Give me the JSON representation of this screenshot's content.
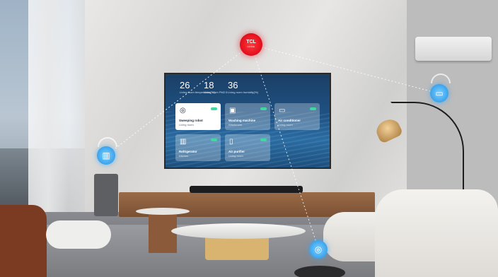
{
  "hub": {
    "brand": "TCL",
    "sub": "HOME",
    "color": "#e10d1c"
  },
  "tv": {
    "stats": [
      {
        "value": "26",
        "label": "Living room temperature(°C)"
      },
      {
        "value": "18",
        "label": "Living room PM2.5"
      },
      {
        "value": "36",
        "label": "Living room humidity(%)"
      }
    ],
    "devices": [
      {
        "name": "Sweeping robot",
        "room": "Living room",
        "icon": "robot-icon",
        "active": true
      },
      {
        "name": "Washing machine",
        "room": "Washroom",
        "icon": "washer-icon",
        "active": false
      },
      {
        "name": "Air conditioner",
        "room": "Living room",
        "icon": "ac-icon",
        "active": false
      },
      {
        "name": "Refrigerator",
        "room": "Kitchen",
        "icon": "fridge-icon",
        "active": false
      },
      {
        "name": "Air purifier",
        "room": "Living room",
        "icon": "purifier-icon",
        "active": false
      }
    ],
    "accent": "#3ed8a0"
  },
  "nodes": [
    {
      "name": "fridge-node",
      "icon": "fridge-icon"
    },
    {
      "name": "ac-node",
      "icon": "ac-icon"
    },
    {
      "name": "robot-node",
      "icon": "robot-icon"
    }
  ],
  "node_color": "#3aa3ec"
}
